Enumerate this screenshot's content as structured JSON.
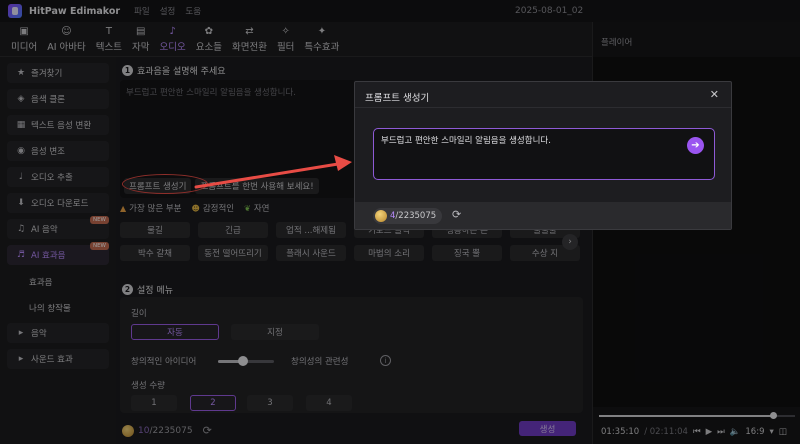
{
  "app": {
    "title": "HitPaw Edimakor",
    "menu": [
      "파일",
      "설정",
      "도움"
    ],
    "document_title": "2025-08-01_02"
  },
  "tabs": [
    {
      "label": "미디어",
      "icon": "media-icon",
      "glyph": "▣"
    },
    {
      "label": "AI 아바타",
      "icon": "avatar-icon",
      "glyph": "☺"
    },
    {
      "label": "텍스트",
      "icon": "text-icon",
      "glyph": "T"
    },
    {
      "label": "자막",
      "icon": "subtitle-icon",
      "glyph": "▤"
    },
    {
      "label": "오디오",
      "icon": "audio-icon",
      "glyph": "♪"
    },
    {
      "label": "요소들",
      "icon": "elements-icon",
      "glyph": "✿"
    },
    {
      "label": "화면전환",
      "icon": "transition-icon",
      "glyph": "⇄"
    },
    {
      "label": "필터",
      "icon": "filter-icon",
      "glyph": "✧"
    },
    {
      "label": "특수효과",
      "icon": "effects-icon",
      "glyph": "✦"
    }
  ],
  "active_tab_index": 4,
  "sidebar": {
    "items": [
      {
        "label": "즐겨찾기",
        "icon": "star-icon",
        "glyph": "★"
      },
      {
        "label": "음색 클론",
        "icon": "voice-clone-icon",
        "glyph": "◈"
      },
      {
        "label": "텍스트 음성 변환",
        "icon": "tts-icon",
        "glyph": "▦"
      },
      {
        "label": "음성 변조",
        "icon": "voice-change-icon",
        "glyph": "◉"
      },
      {
        "label": "오디오 추출",
        "icon": "mic-icon",
        "glyph": "♩"
      },
      {
        "label": "오디오 다운로드",
        "icon": "download-icon",
        "glyph": "⬇"
      },
      {
        "label": "AI 음악",
        "icon": "music-icon",
        "glyph": "♫",
        "badge": "NEW"
      },
      {
        "label": "AI 효과음",
        "icon": "sfx-icon",
        "glyph": "♬",
        "badge": "NEW",
        "active": true
      }
    ],
    "sub_items": [
      {
        "label": "효과음",
        "active": true
      },
      {
        "label": "나의 창작물",
        "active": false
      }
    ],
    "bottom_items": [
      {
        "label": "음악",
        "glyph": "▸"
      },
      {
        "label": "사운드 효과",
        "glyph": "▸"
      }
    ]
  },
  "section1": {
    "number": "1",
    "title": "효과음을 설명해 주세요",
    "placeholder": "부드럽고 편안한 스마일리 알림음을 생성합니다.",
    "generator_button": "프롬프트 생성기",
    "hint_button": "프롬프트를 한번 사용해 보세요!"
  },
  "categories": [
    {
      "label": "가장 많은 부분",
      "icon": "fire-icon",
      "glyph": "▲"
    },
    {
      "label": "감정적인",
      "icon": "smile-icon",
      "glyph": "☻"
    },
    {
      "label": "자연",
      "icon": "leaf-icon",
      "glyph": "❦"
    }
  ],
  "chips": [
    "물길",
    "긴급",
    "업적 ...해제됨",
    "키보드 클릭",
    "생동하는 돈",
    "물불불",
    "박수 갈채",
    "동전 떨어뜨리기",
    "플래시 사운드",
    "마법의 소리",
    "징국 뿔",
    "수상 지"
  ],
  "section2": {
    "number": "2",
    "title": "설정 메뉴",
    "length_label": "길이",
    "length_options": [
      "자동",
      "지정"
    ],
    "length_selected": 0,
    "slider_left": "창의적인 아이디어",
    "slider_right": "창의성의 관련성",
    "slider_value": 0.45,
    "count_label": "생성 수량",
    "count_options": [
      "1",
      "2",
      "3",
      "4"
    ],
    "count_selected": 1
  },
  "footer": {
    "credit_used": "10",
    "credit_total": "/2235075",
    "generate_button": "생성"
  },
  "player": {
    "title": "플레이어",
    "current_time": "01:35:10",
    "total_time": "/ 02:11:04",
    "ratio": "16:9",
    "progress": 0.89
  },
  "dialog": {
    "title": "프롬프트 생성기",
    "input_value": "부드럽고 편안한 스마일리 알림음을 생성합니다.",
    "credit_used": "4",
    "credit_total": "/2235075"
  },
  "colors": {
    "accent": "#9a55f0",
    "annotation": "#e84c45"
  }
}
